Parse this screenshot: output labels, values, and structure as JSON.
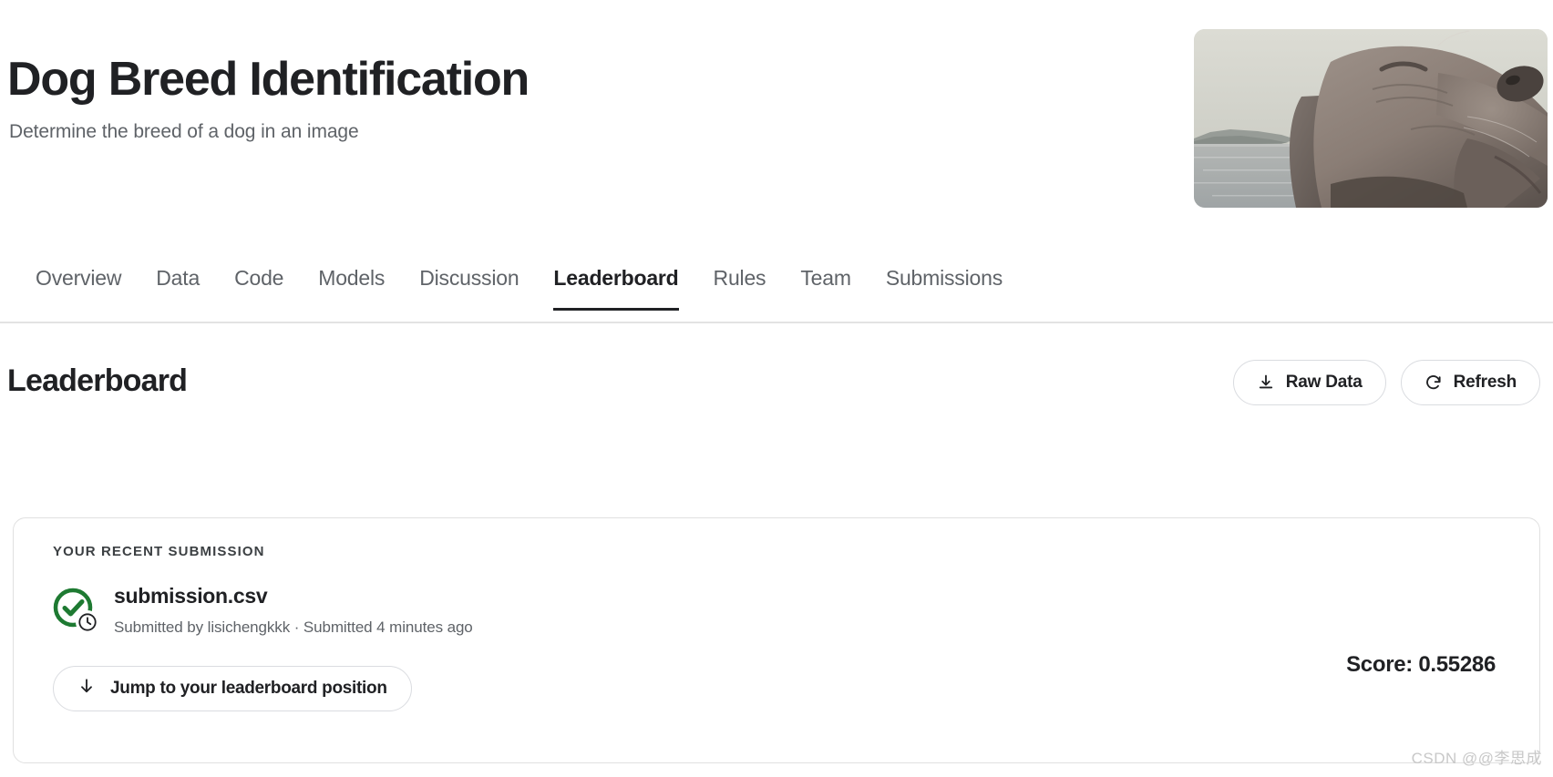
{
  "competition": {
    "title": "Dog Breed Identification",
    "subtitle": "Determine the breed of a dog in an image",
    "hero_alt": "weimaraner-dog-photo"
  },
  "tabs": [
    {
      "label": "Overview",
      "active": false
    },
    {
      "label": "Data",
      "active": false
    },
    {
      "label": "Code",
      "active": false
    },
    {
      "label": "Models",
      "active": false
    },
    {
      "label": "Discussion",
      "active": false
    },
    {
      "label": "Leaderboard",
      "active": true
    },
    {
      "label": "Rules",
      "active": false
    },
    {
      "label": "Team",
      "active": false
    },
    {
      "label": "Submissions",
      "active": false
    }
  ],
  "section": {
    "title": "Leaderboard",
    "raw_data_label": "Raw Data",
    "refresh_label": "Refresh"
  },
  "submission_card": {
    "label": "YOUR RECENT SUBMISSION",
    "filename": "submission.csv",
    "meta": "Submitted by lisichengkkk · Submitted 4 minutes ago",
    "score": "Score: 0.55286",
    "jump_label": "Jump to your leaderboard position",
    "status": "complete-with-pending-badge"
  },
  "watermark": "CSDN @@李思成",
  "colors": {
    "text_primary": "#202124",
    "text_secondary": "#5f6368",
    "border": "#dadce0",
    "success_green": "#1e7a32",
    "divider": "#e3e3e3"
  }
}
